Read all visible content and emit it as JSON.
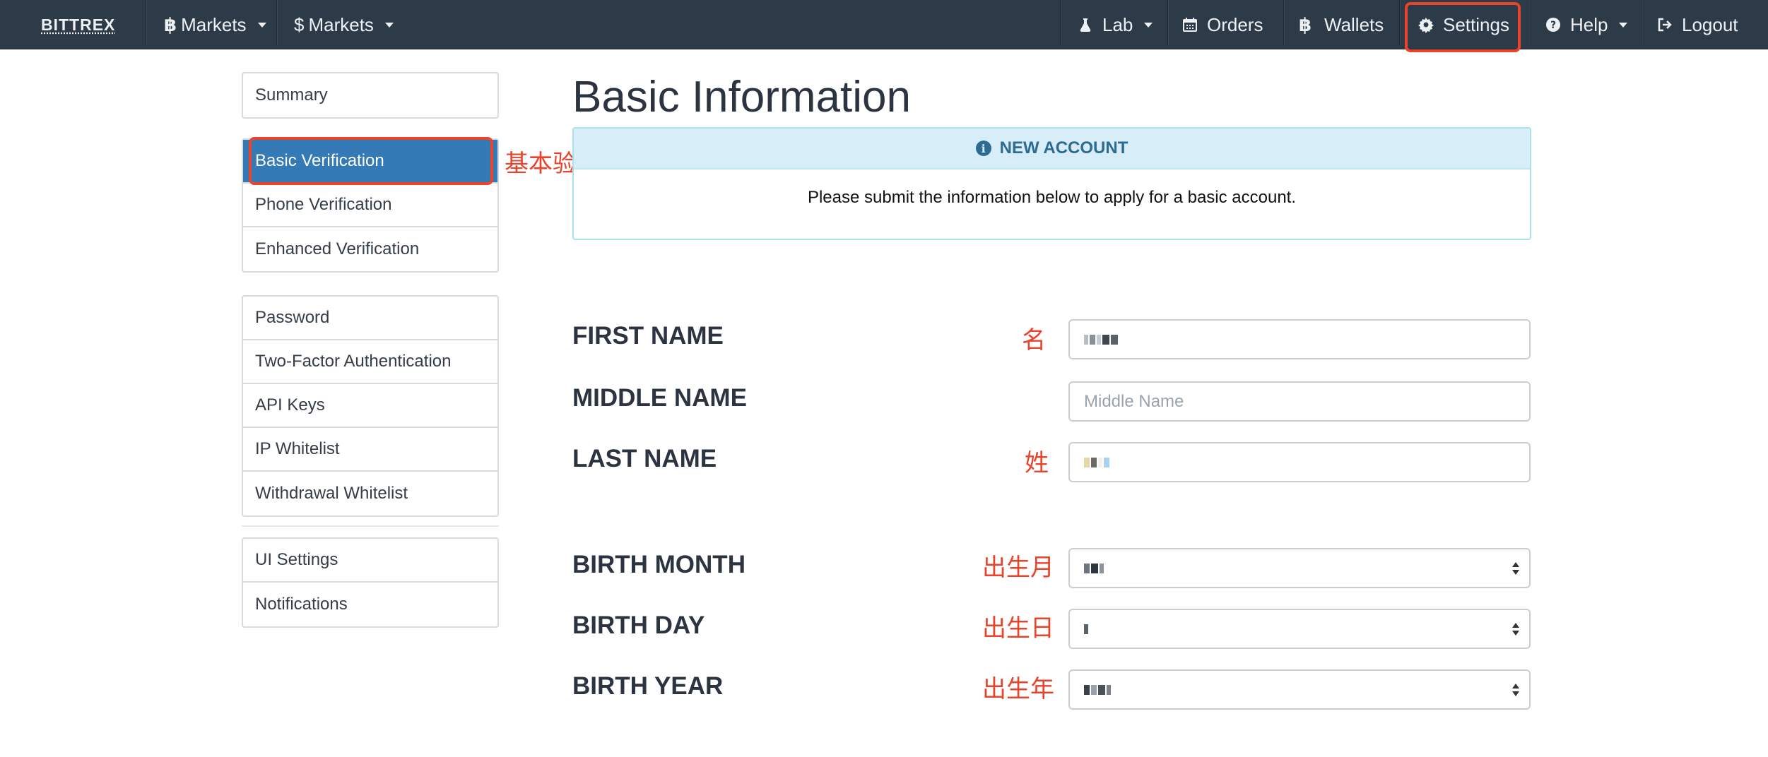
{
  "navbar": {
    "brand": "BITTREX",
    "btc_markets": "Markets",
    "usd_markets": "Markets",
    "lab": "Lab",
    "orders": "Orders",
    "wallets": "Wallets",
    "settings": "Settings",
    "help": "Help",
    "logout": "Logout",
    "btc_symbol": "฿",
    "usd_symbol": "$"
  },
  "sidebar": {
    "group1": [
      {
        "label": "Summary"
      }
    ],
    "group2": [
      {
        "label": "Basic Verification",
        "active": true
      },
      {
        "label": "Phone Verification"
      },
      {
        "label": "Enhanced Verification"
      }
    ],
    "group3": [
      {
        "label": "Password"
      },
      {
        "label": "Two-Factor Authentication"
      },
      {
        "label": "API Keys"
      },
      {
        "label": "IP Whitelist"
      },
      {
        "label": "Withdrawal Whitelist"
      }
    ],
    "group4": [
      {
        "label": "UI Settings"
      },
      {
        "label": "Notifications"
      }
    ]
  },
  "main": {
    "title": "Basic Information",
    "panel": {
      "heading": "NEW ACCOUNT",
      "message": "Please submit the information below to apply for a basic account."
    },
    "fields": {
      "first_name": {
        "label": "FIRST NAME",
        "annotation": "名"
      },
      "middle_name": {
        "label": "MIDDLE NAME",
        "placeholder": "Middle Name"
      },
      "last_name": {
        "label": "LAST NAME",
        "annotation": "姓"
      },
      "birth_month": {
        "label": "BIRTH MONTH",
        "annotation": "出生月"
      },
      "birth_day": {
        "label": "BIRTH DAY",
        "annotation": "出生日"
      },
      "birth_year": {
        "label": "BIRTH YEAR",
        "annotation": "出生年"
      }
    }
  },
  "annotations": {
    "basic_verification": "基本验证"
  },
  "colors": {
    "navbar_bg": "#2d3a48",
    "active_item": "#337ab7",
    "annotation_red": "#e8432b",
    "info_header_bg": "#d7edf7",
    "info_text": "#2d6b93"
  }
}
